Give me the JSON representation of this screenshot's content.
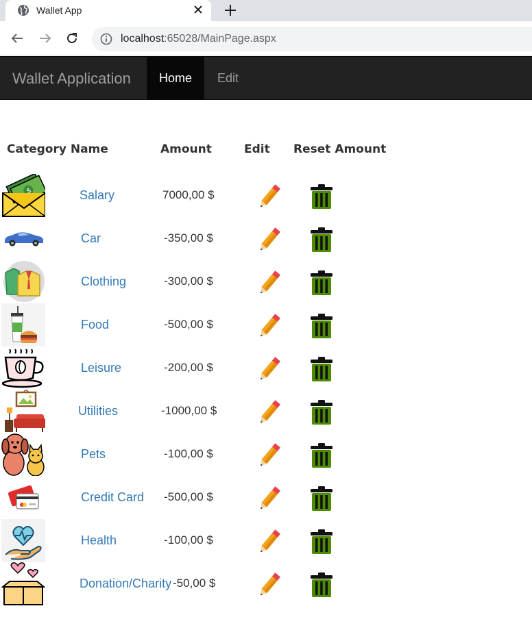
{
  "browser": {
    "tab_title": "Wallet App",
    "url_host": "localhost",
    "url_rest": ":65028/MainPage.aspx"
  },
  "navbar": {
    "brand": "Wallet Application",
    "home": "Home",
    "edit": "Edit"
  },
  "table": {
    "headers": {
      "category_name": "Category Name",
      "amount": "Amount",
      "edit": "Edit",
      "reset_amount": "Reset Amount"
    },
    "rows": [
      {
        "name": "Salary",
        "amount": "7000,00 $",
        "icon": "salary-icon"
      },
      {
        "name": "Car",
        "amount": "-350,00 $",
        "icon": "car-icon"
      },
      {
        "name": "Clothing",
        "amount": "-300,00 $",
        "icon": "clothing-icon"
      },
      {
        "name": "Food",
        "amount": "-500,00 $",
        "icon": "food-icon"
      },
      {
        "name": "Leisure",
        "amount": "-200,00 $",
        "icon": "coffee-cup-icon"
      },
      {
        "name": "Utilities",
        "amount": "-1000,00 $",
        "icon": "utilities-icon"
      },
      {
        "name": "Pets",
        "amount": "-100,00 $",
        "icon": "pets-icon"
      },
      {
        "name": "Credit Card",
        "amount": "-500,00 $",
        "icon": "credit-card-icon"
      },
      {
        "name": "Health",
        "amount": "-100,00 $",
        "icon": "health-icon"
      },
      {
        "name": "Donation/Charity",
        "amount": "-50,00 $",
        "icon": "donation-icon"
      }
    ]
  },
  "colors": {
    "link": "#337ab7",
    "navbar_bg": "#222222",
    "trash_green": "#4d8c00",
    "pencil_orange": "#f0a030"
  }
}
